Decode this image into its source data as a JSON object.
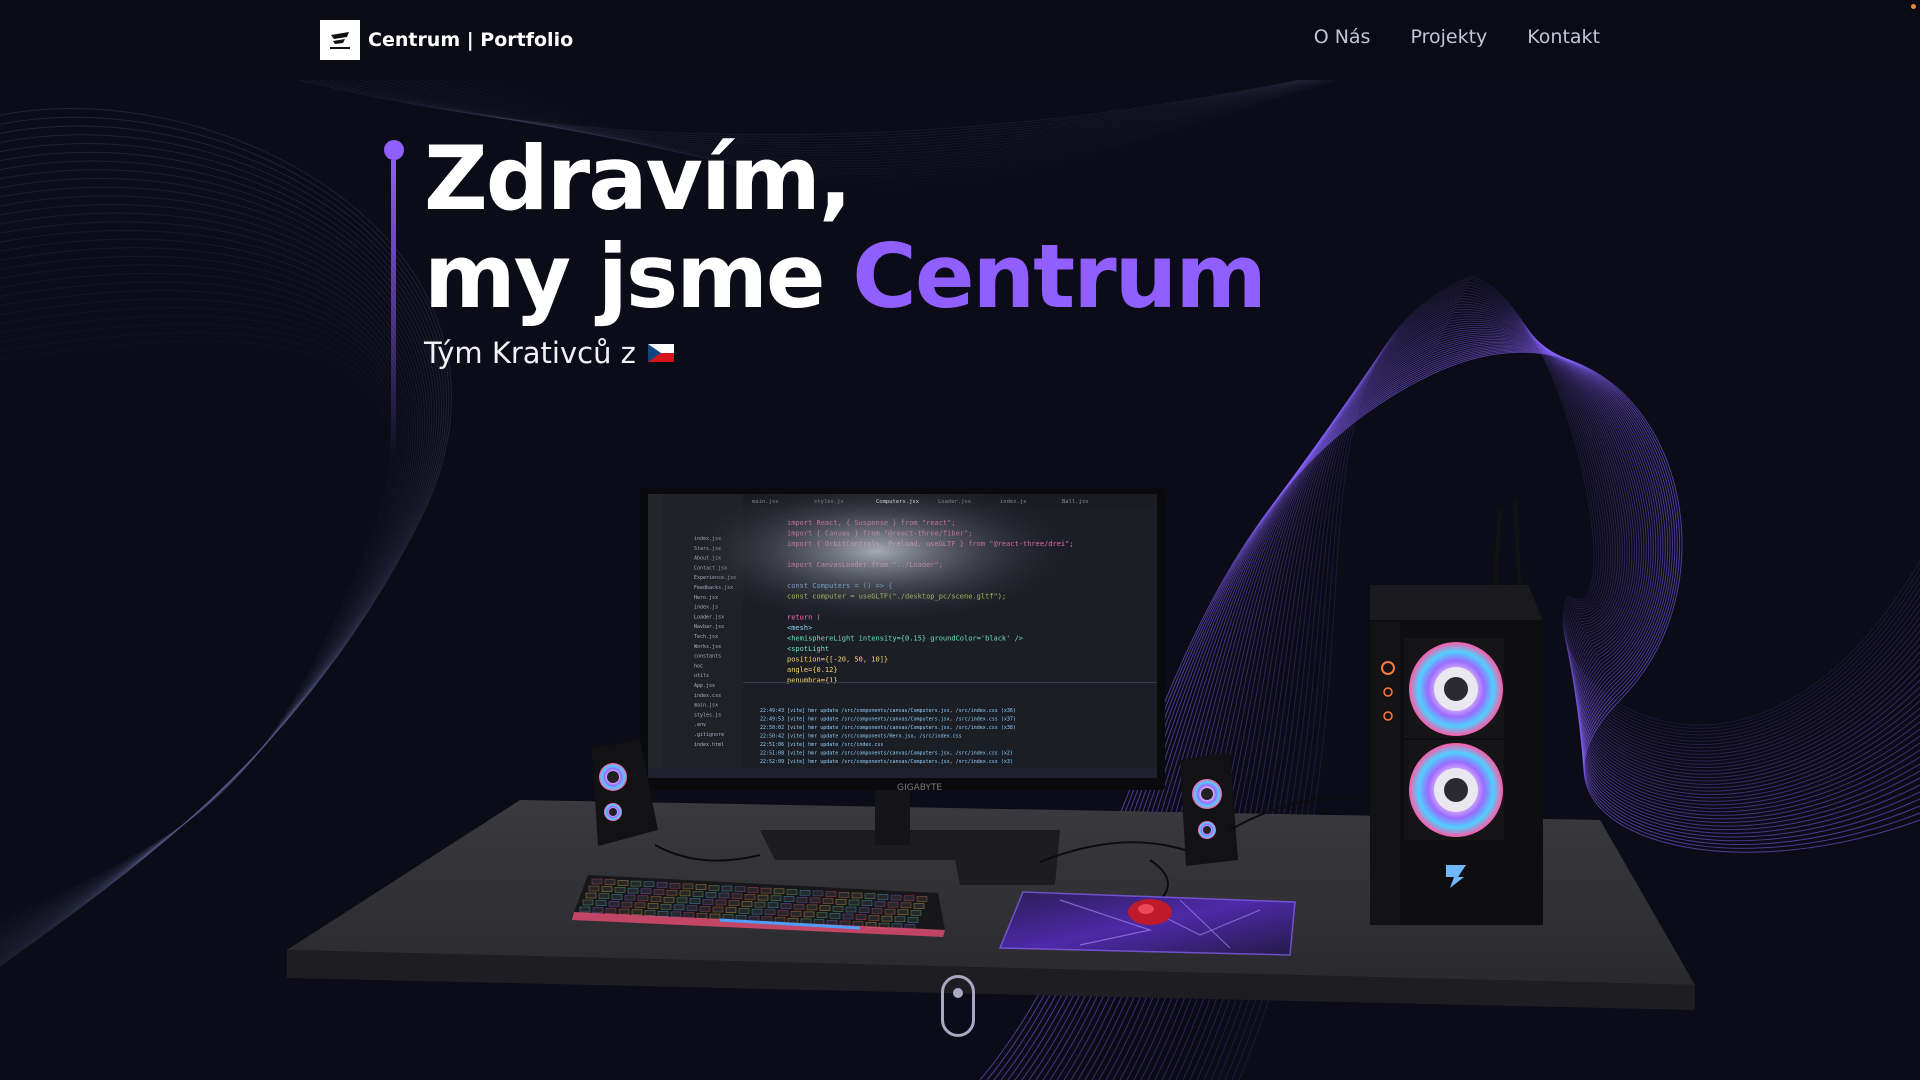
{
  "navbar": {
    "logo_text": "Centrum | Portfolio",
    "links": [
      "O Nás",
      "Projekty",
      "Kontakt"
    ]
  },
  "hero": {
    "line1": "Zdravím,",
    "line2_prefix": "my jsme ",
    "line2_accent": "Centrum",
    "subtitle": "Tým Krativců z"
  },
  "scene": {
    "monitor_brand": "GIGABYTE",
    "code_lines": [
      "import React, { Suspense } from \"react\";",
      "import { Canvas } from \"@react-three/fiber\";",
      "import { OrbitControls, Preload, useGLTF } from \"@react-three/drei\";",
      "",
      "import CanvasLoader from \"../Loader\";",
      "",
      "const Computers = () => {",
      "  const computer = useGLTF(\"./desktop_pc/scene.gltf\");",
      "",
      "  return (",
      "    <mesh>",
      "      <hemisphereLight intensity={0.15} groundColor='black' />",
      "      <spotLight",
      "        position={[-20, 50, 10]}",
      "        angle={0.12}",
      "        penumbra={1}"
    ],
    "terminal_lines": [
      "22:49:43 [vite] hmr update /src/components/canvas/Computers.jsx, /src/index.css (x36)",
      "22:49:53 [vite] hmr update /src/components/canvas/Computers.jsx, /src/index.css (x37)",
      "22:50:02 [vite] hmr update /src/components/canvas/Computers.jsx, /src/index.css (x38)",
      "22:50:42 [vite] hmr update /src/components/Hero.jsx, /src/index.css",
      "22:51:06 [vite] hmr update /src/index.css",
      "22:51:08 [vite] hmr update /src/components/canvas/Computers.jsx, /src/index.css (x2)",
      "22:52:09 [vite] hmr update /src/components/canvas/Computers.jsx, /src/index.css (x3)"
    ],
    "explorer_files": [
      "index.jsx",
      "Stars.jsx",
      "About.jsx",
      "Contact.jsx",
      "Experience.jsx",
      "Feedbacks.jsx",
      "Hero.jsx",
      "index.js",
      "Loader.jsx",
      "Navbar.jsx",
      "Tech.jsx",
      "Works.jsx",
      "constants",
      "hoc",
      "utils",
      "App.jsx",
      "index.css",
      "main.jsx",
      "styles.js",
      ".env",
      ".gitignore",
      "index.html"
    ],
    "tabs": [
      "main.jsx",
      "styles.js",
      "Computers.jsx",
      "Loader.jsx",
      "index.js",
      "Ball.jsx"
    ]
  },
  "colors": {
    "background": "#0b0c17",
    "accent": "#915eff",
    "wave": "#8a63ff"
  },
  "icons": {
    "logo": "centrum-logo-icon",
    "scroll": "mouse-scroll-icon"
  }
}
